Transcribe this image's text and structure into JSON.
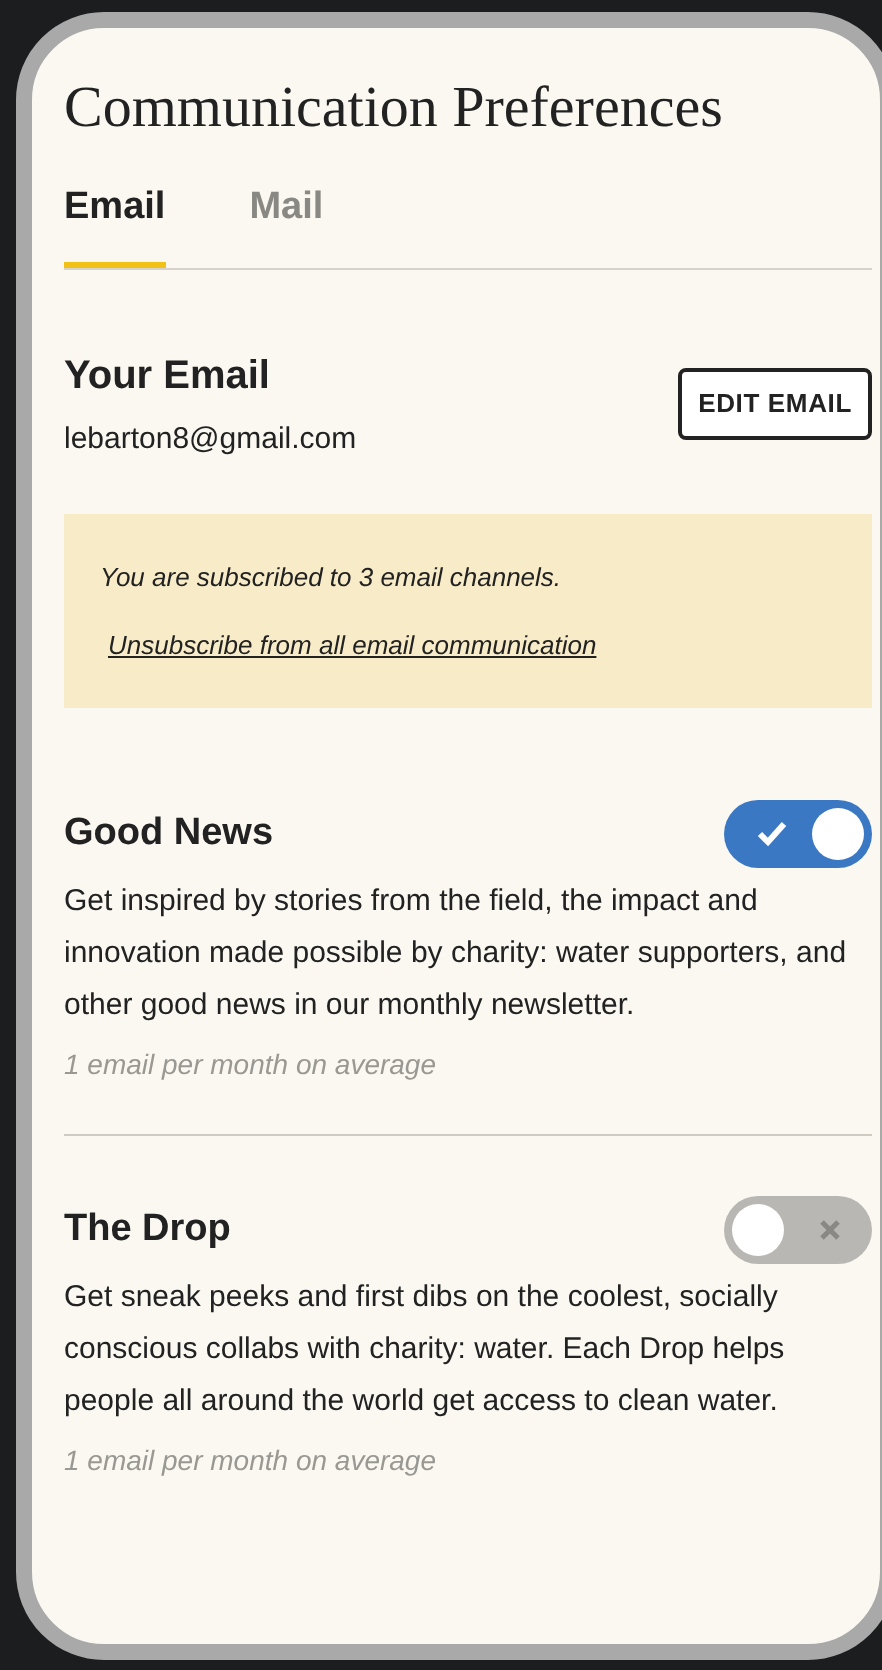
{
  "title": "Communication Preferences",
  "tabs": [
    {
      "label": "Email",
      "selected": true
    },
    {
      "label": "Mail",
      "selected": false
    }
  ],
  "email_section": {
    "heading": "Your Email",
    "address": "lebarton8@gmail.com",
    "button": "EDIT EMAIL"
  },
  "notice": {
    "message": "You are subscribed to 3 email channels.",
    "link": "Unsubscribe from all email communication"
  },
  "channels": [
    {
      "name": "Good News",
      "on": true,
      "description": "Get inspired by stories from the field, the impact and innovation made possible by charity: water supporters, and other good news in our monthly newsletter.",
      "frequency": "1 email per month on average"
    },
    {
      "name": "The Drop",
      "on": false,
      "description": "Get sneak peeks and first dibs on the coolest, socially conscious collabs with charity: water. Each Drop helps people all around the world get access to clean water.",
      "frequency": "1 email per month on average"
    }
  ]
}
